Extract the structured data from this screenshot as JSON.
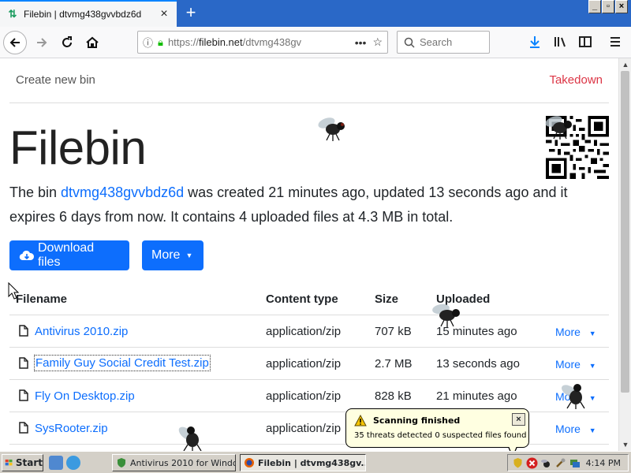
{
  "browser": {
    "tab_title": "Filebin | dtvmg438gvvbdz6d",
    "new_tab_symbol": "+",
    "url_prefix": "https://",
    "url_domain": "filebin.net",
    "url_path": "/dtvmg438gv",
    "search_placeholder": "Search",
    "window_controls": [
      "_",
      "▫",
      "×"
    ]
  },
  "page": {
    "create_new_bin": "Create new bin",
    "takedown": "Takedown",
    "title": "Filebin",
    "intro": {
      "the_bin": "The bin ",
      "bin_id": "dtvmg438gvvbdz6d",
      "rest": " was created 21 minutes ago, updated 13 seconds ago and it expires 6 days from now. It contains 4 uploaded files at 4.3 MB in total."
    },
    "download_button": "Download files",
    "more_button": "More",
    "table": {
      "headers": [
        "Filename",
        "Content type",
        "Size",
        "Uploaded"
      ],
      "rows": [
        {
          "filename": "Antivirus 2010.zip",
          "content_type": "application/zip",
          "size": "707 kB",
          "uploaded": "15 minutes ago",
          "more": "More"
        },
        {
          "filename": "Family Guy Social Credit Test.zip",
          "content_type": "application/zip",
          "size": "2.7 MB",
          "uploaded": "13 seconds ago",
          "more": "More"
        },
        {
          "filename": "Fly On Desktop.zip",
          "content_type": "application/zip",
          "size": "828 kB",
          "uploaded": "21 minutes ago",
          "more": "More"
        },
        {
          "filename": "SysRooter.zip",
          "content_type": "application/zip",
          "size": "",
          "uploaded": "",
          "more": "More"
        }
      ]
    }
  },
  "notification": {
    "title": "Scanning finished",
    "message": "35 threats detected 0 suspected files found",
    "close": "×"
  },
  "taskbar": {
    "start": "Start",
    "tasks": [
      "Antivirus 2010 for Windo...",
      "Filebin | dtvmg438gv..."
    ],
    "clock": "4:14 PM"
  },
  "colors": {
    "accent": "#0d6efd",
    "takedown": "#dc3545",
    "tabstrip": "#2a68c7",
    "taskbar": "#d4d0c8",
    "balloon": "#ffffe1"
  }
}
